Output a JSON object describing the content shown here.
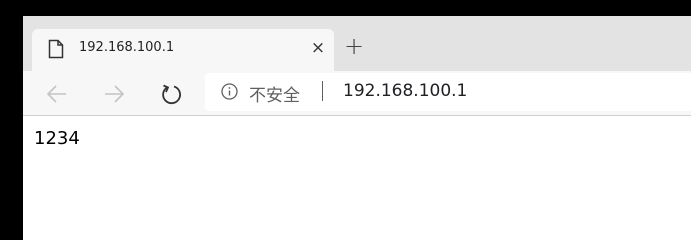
{
  "tab": {
    "title": "192.168.100.1",
    "icon": "page-icon",
    "close_label": "×"
  },
  "new_tab_label": "+",
  "toolbar": {
    "back_icon": "back-arrow-icon",
    "forward_icon": "forward-arrow-icon",
    "reload_icon": "reload-icon"
  },
  "address_bar": {
    "security_icon": "info-icon",
    "security_text": "不安全",
    "url": "192.168.100.1"
  },
  "page": {
    "text": "1234"
  },
  "colors": {
    "outer_background": "#000000",
    "tabstrip": "#e3e3e3",
    "toolbar": "#f7f7f7",
    "nav_disabled": "#c4c4c4",
    "nav_enabled": "#333333"
  }
}
